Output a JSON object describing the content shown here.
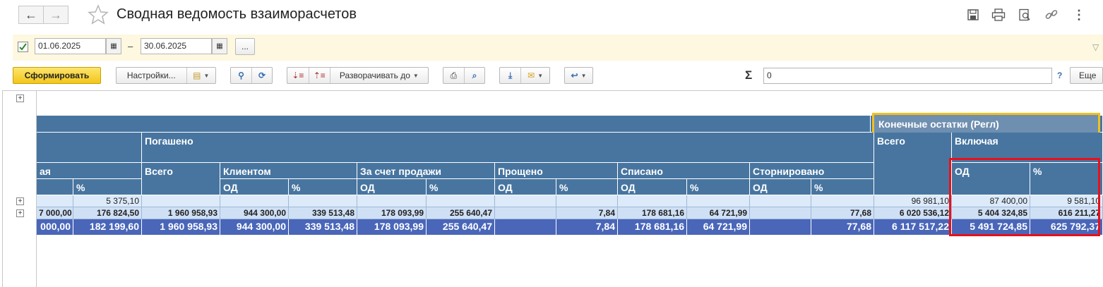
{
  "window": {
    "title": "Сводная ведомость взаиморасчетов"
  },
  "period": {
    "date_from": "01.06.2025",
    "dash": "–",
    "date_to": "30.06.2025",
    "more_label": "..."
  },
  "toolbar": {
    "generate_label": "Сформировать",
    "settings_label": "Настройки...",
    "expand_label": "Разворачивать до",
    "sigma": "Σ",
    "sum_value": "0",
    "help": "?",
    "more_label": "Еще"
  },
  "report": {
    "headers": {
      "final_balances": "Конечные остатки (Регл)",
      "repaid": "Погашено",
      "total": "Всего",
      "including": "Включая",
      "partial_left": "ая",
      "client": "Клиентом",
      "by_sale": "За счет продажи",
      "forgiven": "Прощено",
      "written_off": "Списано",
      "reversed": "Сторнировано",
      "od": "ОД",
      "pct": "%"
    },
    "rows": [
      [
        "",
        "5 375,10",
        "",
        "",
        "",
        "",
        "",
        "",
        "",
        "",
        "",
        "",
        "",
        "96 981,10",
        "87 400,00",
        "9 581,10"
      ],
      [
        "7 000,00",
        "176 824,50",
        "1 960 958,93",
        "944 300,00",
        "339 513,48",
        "178 093,99",
        "255 640,47",
        "",
        "7,84",
        "178 681,16",
        "64 721,99",
        "",
        "77,68",
        "6 020 536,12",
        "5 404 324,85",
        "616 211,27"
      ]
    ],
    "totals": [
      "000,00",
      "182 199,60",
      "1 960 958,93",
      "944 300,00",
      "339 513,48",
      "178 093,99",
      "255 640,47",
      "",
      "7,84",
      "178 681,16",
      "64 721,99",
      "",
      "77,68",
      "6 117 517,22",
      "5 491 724,85",
      "625 792,37"
    ]
  },
  "colors": {
    "header_bg": "#4775a0",
    "total_bg": "#4a66b9",
    "highlight_red": "#e8101a",
    "highlight_yellow": "#f0c020"
  }
}
